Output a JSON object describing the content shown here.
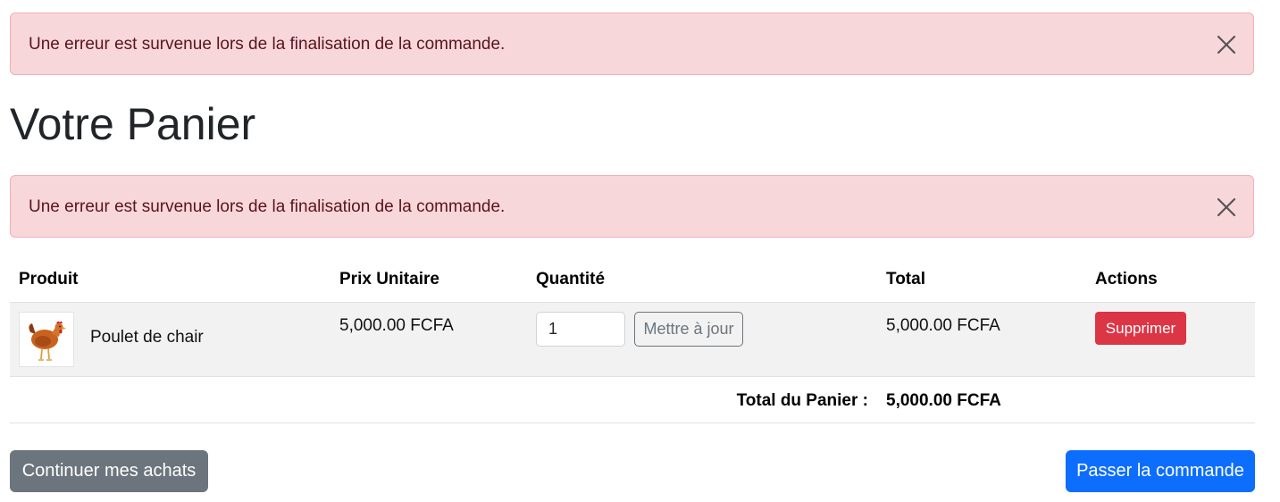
{
  "alerts": [
    {
      "message": "Une erreur est survenue lors de la finalisation de la commande."
    },
    {
      "message": "Une erreur est survenue lors de la finalisation de la commande."
    }
  ],
  "page": {
    "title": "Votre Panier"
  },
  "cart": {
    "columns": [
      "Produit",
      "Prix Unitaire",
      "Quantité",
      "Total",
      "Actions"
    ],
    "items": [
      {
        "product_name": "Poulet de chair",
        "image": "chicken-image",
        "unit_price": "5,000.00 FCFA",
        "quantity": "1",
        "total": "5,000.00 FCFA",
        "update_label": "Mettre à jour",
        "delete_label": "Supprimer"
      }
    ],
    "total_label": "Total du Panier :",
    "total_value": "5,000.00 FCFA"
  },
  "actions": {
    "continue_label": "Continuer mes achats",
    "checkout_label": "Passer la commande"
  },
  "colors": {
    "alert_bg": "#f8d7da",
    "danger": "#dc3545",
    "primary": "#0d6efd",
    "secondary": "#6c757d"
  }
}
